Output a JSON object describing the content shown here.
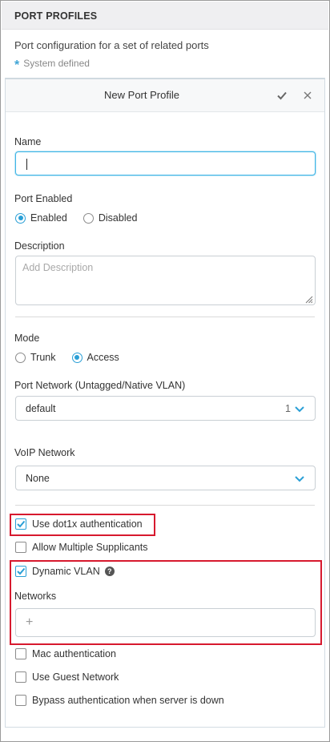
{
  "header": {
    "title": "PORT PROFILES"
  },
  "description_text": "Port configuration for a set of related ports",
  "legend": {
    "symbol": "*",
    "text": "System defined"
  },
  "panel": {
    "title": "New Port Profile",
    "icons": {
      "save": "checkmark-icon",
      "close": "close-icon"
    }
  },
  "form": {
    "name": {
      "label": "Name",
      "value": ""
    },
    "port_enabled": {
      "label": "Port Enabled",
      "options": [
        "Enabled",
        "Disabled"
      ],
      "selected": "Enabled"
    },
    "description": {
      "label": "Description",
      "placeholder": "Add Description"
    },
    "mode": {
      "label": "Mode",
      "options": [
        "Trunk",
        "Access"
      ],
      "selected": "Access"
    },
    "port_network": {
      "label": "Port Network (Untagged/Native VLAN)",
      "value": "default",
      "vlan": "1"
    },
    "voip_network": {
      "label": "VoIP Network",
      "value": "None"
    },
    "checkboxes": {
      "use_dot1x": {
        "label": "Use dot1x authentication",
        "checked": true
      },
      "allow_multiple": {
        "label": "Allow Multiple Supplicants",
        "checked": false
      },
      "dynamic_vlan": {
        "label": "Dynamic VLAN",
        "checked": true,
        "help": "?"
      },
      "mac_auth": {
        "label": "Mac authentication",
        "checked": false
      },
      "guest_network": {
        "label": "Use Guest Network",
        "checked": false
      },
      "bypass_auth": {
        "label": "Bypass authentication when server is down",
        "checked": false
      }
    },
    "networks": {
      "label": "Networks",
      "add_symbol": "+"
    }
  },
  "colors": {
    "accent": "#2a9fd6",
    "focus": "#41b6e6",
    "highlight": "#d7192e",
    "header_bg": "#efeff1"
  }
}
